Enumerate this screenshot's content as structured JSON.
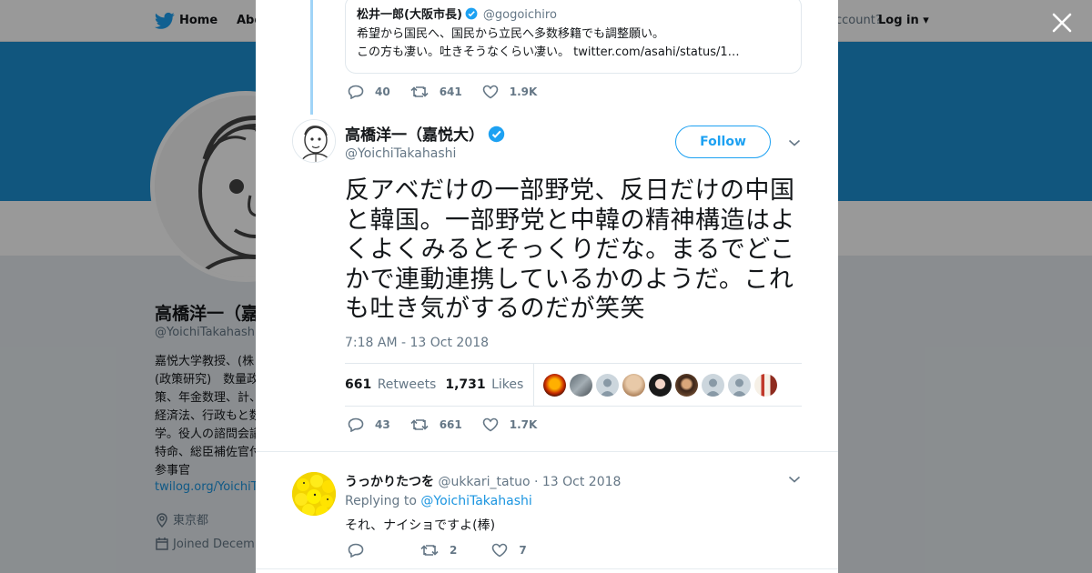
{
  "background": {
    "nav": {
      "home": "Home",
      "about": "Abo",
      "account": "ccount?",
      "login": "Log in"
    },
    "profile": {
      "name": "高橋洋一（嘉",
      "handle": "@YoichiTakahash",
      "bio": "嘉悦大学教授、(株(政策研究)　数量政策、年金数理、計、経済法、行政もと数学。役人の諮問会議特命、総臣補佐官付参事官",
      "link": "twilog.org/YoichiTa",
      "location": "東京都",
      "joined": "Joined Decem"
    }
  },
  "quoted_tweet": {
    "name": "松井一郎(大阪市長)",
    "handle": "@gogoichiro",
    "line1": "希望から国民へ、国民から立民へ多数移籍でも調整願い。",
    "line2": "この方も凄い。吐きそうなくらい凄い。 twitter.com/asahi/status/1…",
    "replies": "40",
    "retweets": "641",
    "likes": "1.9K"
  },
  "main_tweet": {
    "name": "高橋洋一（嘉悦大）",
    "handle": "@YoichiTakahashi",
    "follow_label": "Follow",
    "text": "反アベだけの一部野党、反日だけの中国と韓国。一部野党と中韓の精神構造はよくよくみるとそっくりだな。まるでどこかで連動連携しているかのようだ。これも吐き気がするのだが笑笑",
    "timestamp": "7:18 AM - 13 Oct 2018",
    "retweets_count": "661",
    "retweets_label": "Retweets",
    "likes_count": "1,731",
    "likes_label": "Likes",
    "replies": "43",
    "retweets": "661",
    "likes": "1.7K"
  },
  "reply_tweet": {
    "name": "うっかりたつを",
    "handle": "@ukkari_tatuo",
    "date": "· 13 Oct 2018",
    "replying_label": "Replying to",
    "replying_to": "@YoichiTakahashi",
    "text": "それ、ナイショですよ(棒)",
    "replies": "",
    "retweets": "2",
    "likes": "7"
  },
  "colors": {
    "brand_blue": "#1da1f2",
    "link_blue": "#1b95e0",
    "text": "#14171a",
    "muted": "#657786",
    "thread_line": "#a0d4f7"
  },
  "icons": [
    "twitter-bird-icon",
    "close-icon",
    "reply-icon",
    "retweet-icon",
    "like-icon",
    "verified-badge-icon",
    "chevron-down-icon",
    "location-icon",
    "calendar-icon"
  ]
}
